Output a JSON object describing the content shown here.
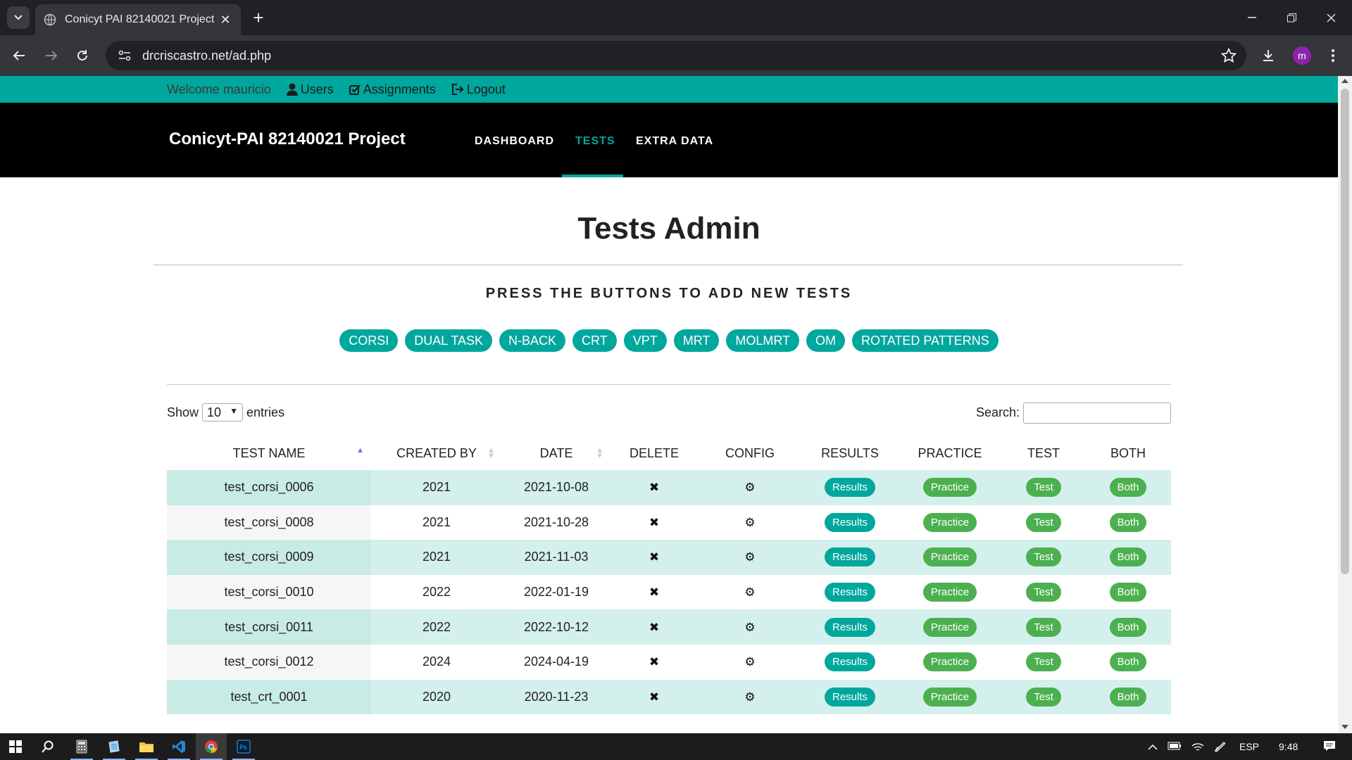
{
  "browser": {
    "tab_title": "Conicyt PAI 82140021 Project",
    "url": "drcriscastro.net/ad.php",
    "profile_initial": "m"
  },
  "topbar": {
    "welcome": "Welcome mauricio",
    "users": "Users",
    "assignments": "Assignments",
    "logout": "Logout"
  },
  "navbar": {
    "brand": "Conicyt-PAI 82140021 Project",
    "items": [
      "DASHBOARD",
      "TESTS",
      "EXTRA DATA"
    ],
    "active": "TESTS"
  },
  "main": {
    "title": "Tests Admin",
    "subtitle": "PRESS THE BUTTONS TO ADD NEW TESTS",
    "test_buttons": [
      "CORSI",
      "DUAL TASK",
      "N-BACK",
      "CRT",
      "VPT",
      "MRT",
      "MOLMRT",
      "OM",
      "ROTATED PATTERNS"
    ]
  },
  "table_controls": {
    "show_label": "Show",
    "entries_value": "10",
    "entries_label": "entries",
    "search_label": "Search:",
    "search_value": ""
  },
  "table": {
    "columns": [
      "TEST NAME",
      "CREATED BY",
      "DATE",
      "DELETE",
      "CONFIG",
      "RESULTS",
      "PRACTICE",
      "TEST",
      "BOTH"
    ],
    "action_labels": {
      "results": "Results",
      "practice": "Practice",
      "test": "Test",
      "both": "Both"
    },
    "rows": [
      {
        "name": "test_corsi_0006",
        "created_by": "2021",
        "date": "2021-10-08"
      },
      {
        "name": "test_corsi_0008",
        "created_by": "2021",
        "date": "2021-10-28"
      },
      {
        "name": "test_corsi_0009",
        "created_by": "2021",
        "date": "2021-11-03"
      },
      {
        "name": "test_corsi_0010",
        "created_by": "2022",
        "date": "2022-01-19"
      },
      {
        "name": "test_corsi_0011",
        "created_by": "2022",
        "date": "2022-10-12"
      },
      {
        "name": "test_corsi_0012",
        "created_by": "2024",
        "date": "2024-04-19"
      },
      {
        "name": "test_crt_0001",
        "created_by": "2020",
        "date": "2020-11-23"
      }
    ]
  },
  "taskbar": {
    "language": "ESP",
    "time": "9:48"
  },
  "colors": {
    "accent": "#00a79d",
    "green": "#4cb050",
    "row_stripe": "#d4f0ec"
  }
}
